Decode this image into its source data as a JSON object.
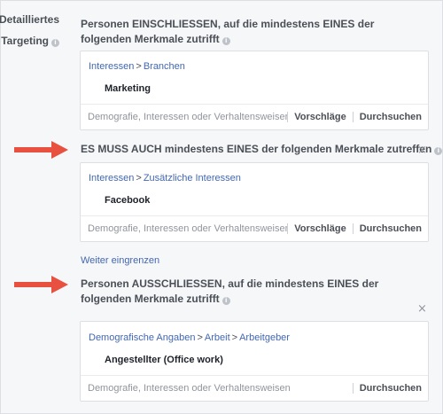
{
  "sidebar": {
    "label_line1": "Detailliertes",
    "label_line2": "Targeting"
  },
  "include": {
    "heading": "Personen EINSCHLIESSEN, auf die mindestens EINES der folgenden Merkmale zutrifft",
    "breadcrumb": [
      "Interessen",
      "Branchen"
    ],
    "selected": "Marketing",
    "placeholder": "Demografie, Interessen oder Verhaltensweisen",
    "suggest_label": "Vorschläge",
    "browse_label": "Durchsuchen"
  },
  "must_also": {
    "heading": "ES MUSS AUCH mindestens EINES der folgenden Merkmale zutreffen",
    "breadcrumb": [
      "Interessen",
      "Zusätzliche Interessen"
    ],
    "selected": "Facebook",
    "placeholder": "Demografie, Interessen oder Verhaltensweisen",
    "suggest_label": "Vorschläge",
    "browse_label": "Durchsuchen"
  },
  "narrow_link": "Weiter eingrenzen",
  "exclude": {
    "heading": "Personen AUSSCHLIESSEN, auf die mindestens EINES der folgenden Merkmale zutrifft",
    "breadcrumb": [
      "Demografische Angaben",
      "Arbeit",
      "Arbeitgeber"
    ],
    "selected": "Angestellter (Office work)",
    "placeholder": "Demografie, Interessen oder Verhaltensweisen",
    "browse_label": "Durchsuchen"
  },
  "separator": ">",
  "close_glyph": "×",
  "info_glyph": "i",
  "colors": {
    "arrow": "#e8513f",
    "link": "#4267b2",
    "background": "#f6f7f9"
  }
}
